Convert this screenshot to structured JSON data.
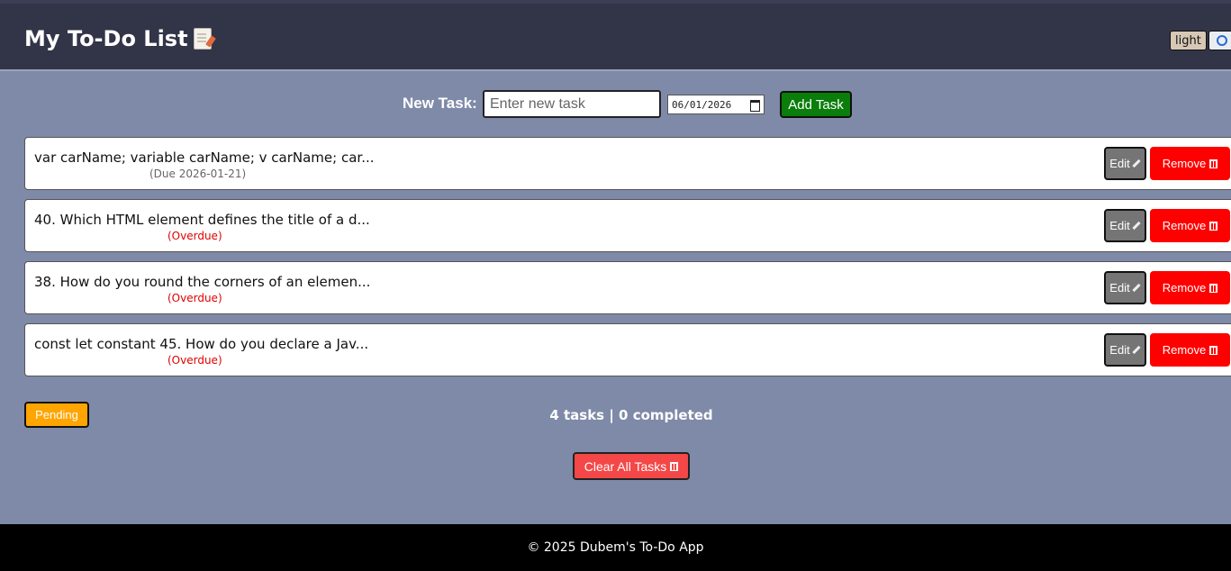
{
  "header": {
    "title": "My To-Do List",
    "title_icon": "memo-icon",
    "theme_toggle_label": "light",
    "search_icon": "search-icon"
  },
  "form": {
    "label": "New Task:",
    "input_placeholder": "Enter new task",
    "input_value": "",
    "date_value": "06/01/2026",
    "add_button_label": "Add Task"
  },
  "tasks": [
    {
      "text": "var carName; variable carName; v carName; car...",
      "due": "(Due 2026-01-21)",
      "overdue": false
    },
    {
      "text": "40. Which HTML element defines the title of a d...",
      "due": "(Overdue)",
      "overdue": true
    },
    {
      "text": "38. How do you round the corners of an elemen...",
      "due": "(Overdue)",
      "overdue": true
    },
    {
      "text": "const let constant 45. How do you declare a Jav...",
      "due": "(Overdue)",
      "overdue": true
    }
  ],
  "task_actions": {
    "edit_label": "Edit",
    "remove_label": "Remove"
  },
  "filter": {
    "pending_label": "Pending"
  },
  "stats": {
    "summary": "4 tasks | 0 completed"
  },
  "clear_all_label": "Clear All Tasks",
  "footer": {
    "text": "© 2025 Dubem's To-Do App"
  },
  "colors": {
    "header_bg": "#323448",
    "page_bg": "#7f8aa8",
    "add_button": "#0a7d0a",
    "remove_button": "#ff0000",
    "edit_button": "#757575",
    "pending_button": "#ffa500",
    "overdue_text": "#e00000"
  }
}
